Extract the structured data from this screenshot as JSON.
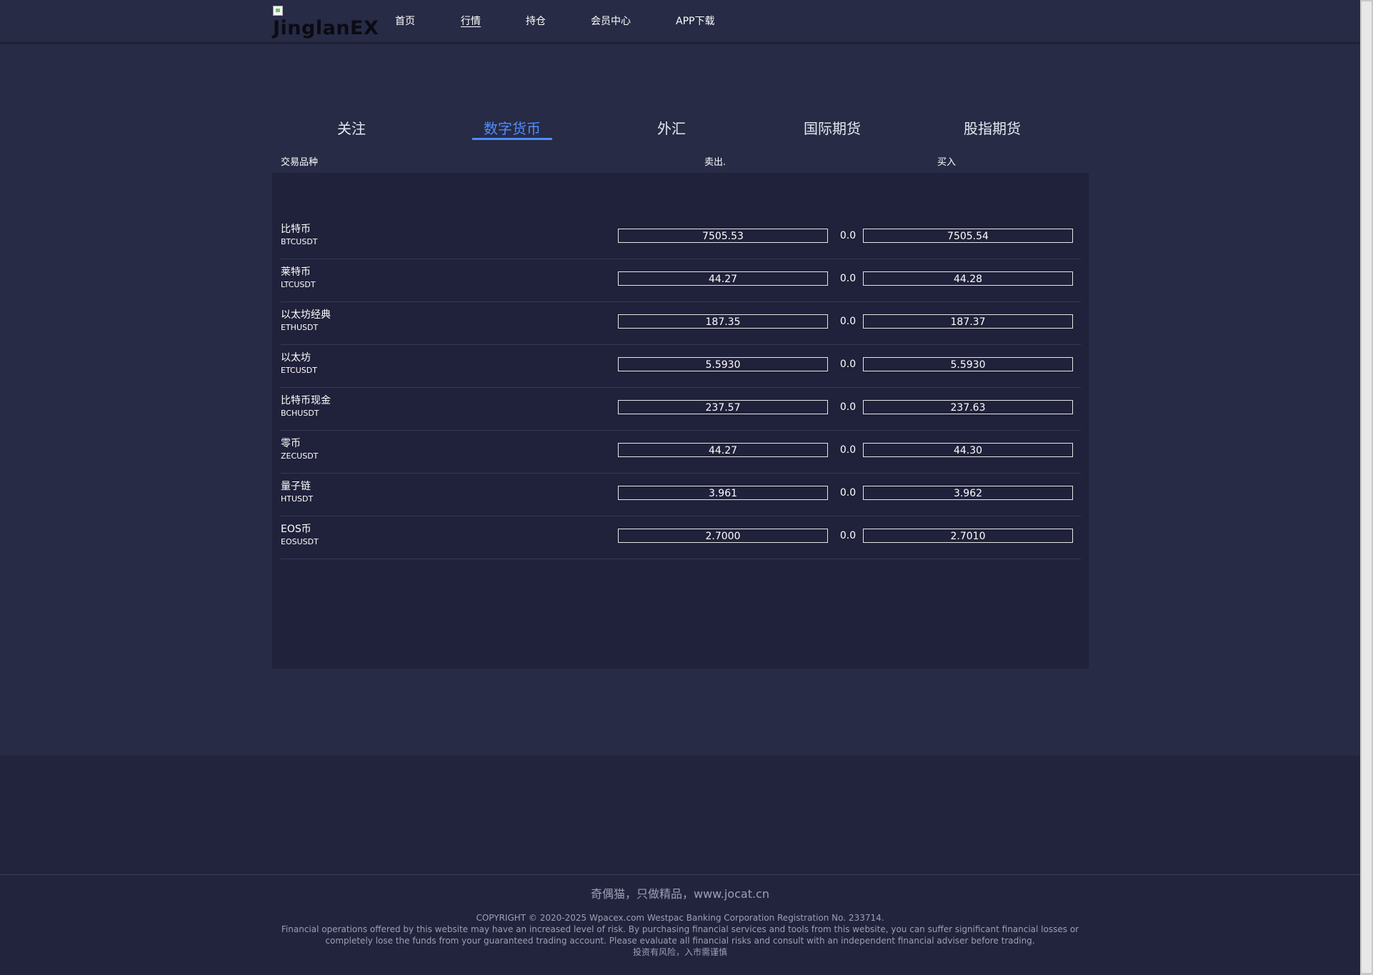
{
  "header": {
    "logo_alt": "JinglanEX",
    "nav": [
      "首页",
      "行情",
      "持仓",
      "会员中心",
      "APP下载"
    ],
    "active_nav": "行情"
  },
  "tabs": {
    "items": [
      "关注",
      "数字货币",
      "外汇",
      "国际期货",
      "股指期货"
    ],
    "active": "数字货币"
  },
  "columns": {
    "symbol": "交易品种",
    "sell": "卖出.",
    "buy": "买入"
  },
  "rows": [
    {
      "name": "比特币",
      "code": "BTCUSDT",
      "sell": "7505.53",
      "change": "0.0",
      "buy": "7505.54"
    },
    {
      "name": "莱特币",
      "code": "LTCUSDT",
      "sell": "44.27",
      "change": "0.0",
      "buy": "44.28"
    },
    {
      "name": "以太坊经典",
      "code": "ETHUSDT",
      "sell": "187.35",
      "change": "0.0",
      "buy": "187.37"
    },
    {
      "name": "以太坊",
      "code": "ETCUSDT",
      "sell": "5.5930",
      "change": "0.0",
      "buy": "5.5930"
    },
    {
      "name": "比特币现金",
      "code": "BCHUSDT",
      "sell": "237.57",
      "change": "0.0",
      "buy": "237.63"
    },
    {
      "name": "零币",
      "code": "ZECUSDT",
      "sell": "44.27",
      "change": "0.0",
      "buy": "44.30"
    },
    {
      "name": "量子链",
      "code": "HTUSDT",
      "sell": "3.961",
      "change": "0.0",
      "buy": "3.962"
    },
    {
      "name": "EOS币",
      "code": "EOSUSDT",
      "sell": "2.7000",
      "change": "0.0",
      "buy": "2.7010"
    }
  ],
  "footer": {
    "slogan": "奇偶猫，只做精品，www.jocat.cn",
    "copyright": "COPYRIGHT © 2020-2025 Wpacex.com Westpac Banking Corporation Registration No. 233714.",
    "risk_line1": "Financial operations offered by this website may have an increased level of risk. By purchasing financial services and tools from this website, you can suffer significant financial losses or",
    "risk_line2": "completely lose the funds from your guaranteed trading account. Please evaluate all financial risks and consult with an independent financial adviser before trading.",
    "warning": "投资有风险，入市需谨慎"
  },
  "colors": {
    "background": "#272b45",
    "panel": "#20213a",
    "accent": "#4f8cff"
  }
}
